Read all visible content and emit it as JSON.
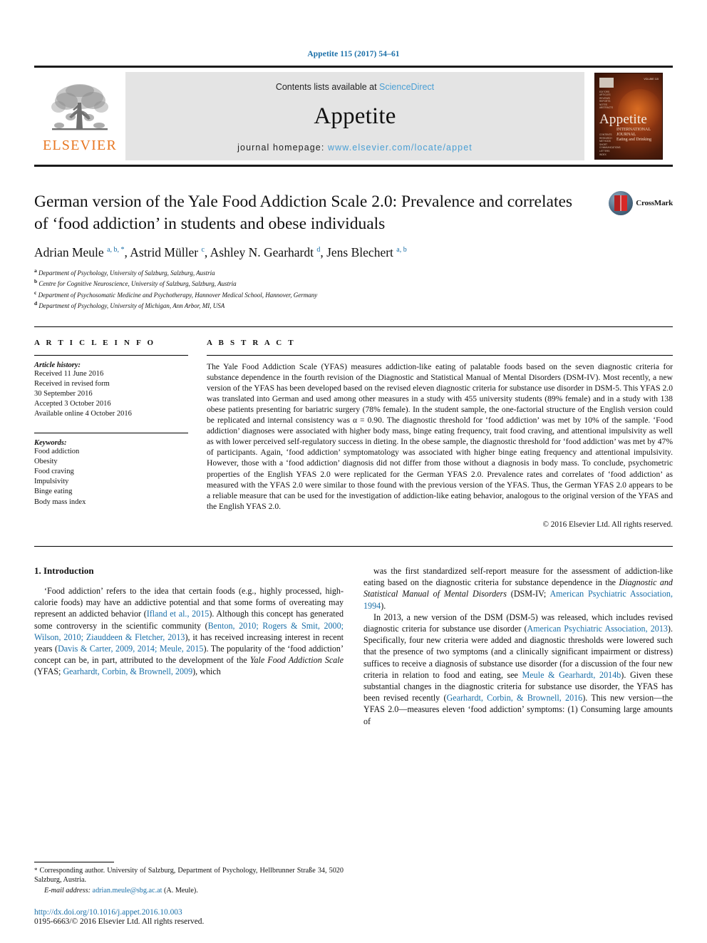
{
  "running_head": "Appetite 115 (2017) 54–61",
  "masthead": {
    "publisher_name": "ELSEVIER",
    "publisher_logo_icon": "elsevier-tree-icon",
    "contents_prefix": "Contents lists available at ",
    "contents_link": "ScienceDirect",
    "journal_name": "Appetite",
    "homepage_prefix": "journal homepage: ",
    "homepage_url": "www.elsevier.com/locate/appet",
    "cover": {
      "title": "Appetite",
      "subtitle_line1": "INTERNATIONAL JOURNAL",
      "subtitle_line2": "Eating and Drinking",
      "corner_text": "VOLUME 115"
    }
  },
  "article": {
    "title": "German version of the Yale Food Addiction Scale 2.0: Prevalence and correlates of ‘food addiction’ in students and obese individuals",
    "crossmark_label": "CrossMark",
    "authors_html": "Adrian Meule <sup>a, b, *</sup>, Astrid Müller <sup>c</sup>, Ashley N. Gearhardt <sup>d</sup>, Jens Blechert <sup>a, b</sup>",
    "affiliations": [
      {
        "marker": "a",
        "text": "Department of Psychology, University of Salzburg, Salzburg, Austria"
      },
      {
        "marker": "b",
        "text": "Centre for Cognitive Neuroscience, University of Salzburg, Salzburg, Austria"
      },
      {
        "marker": "c",
        "text": "Department of Psychosomatic Medicine and Psychotherapy, Hannover Medical School, Hannover, Germany"
      },
      {
        "marker": "d",
        "text": "Department of Psychology, University of Michigan, Ann Arbor, MI, USA"
      }
    ]
  },
  "article_info": {
    "heading": "A R T I C L E  I N F O",
    "history_label": "Article history:",
    "history": [
      "Received 11 June 2016",
      "Received in revised form",
      "30 September 2016",
      "Accepted 3 October 2016",
      "Available online 4 October 2016"
    ],
    "keywords_label": "Keywords:",
    "keywords": [
      "Food addiction",
      "Obesity",
      "Food craving",
      "Impulsivity",
      "Binge eating",
      "Body mass index"
    ]
  },
  "abstract": {
    "heading": "A B S T R A C T",
    "text": "The Yale Food Addiction Scale (YFAS) measures addiction-like eating of palatable foods based on the seven diagnostic criteria for substance dependence in the fourth revision of the Diagnostic and Statistical Manual of Mental Disorders (DSM-IV). Most recently, a new version of the YFAS has been developed based on the revised eleven diagnostic criteria for substance use disorder in DSM-5. This YFAS 2.0 was translated into German and used among other measures in a study with 455 university students (89% female) and in a study with 138 obese patients presenting for bariatric surgery (78% female). In the student sample, the one-factorial structure of the English version could be replicated and internal consistency was α = 0.90. The diagnostic threshold for ‘food addiction’ was met by 10% of the sample. ‘Food addiction’ diagnoses were associated with higher body mass, binge eating frequency, trait food craving, and attentional impulsivity as well as with lower perceived self-regulatory success in dieting. In the obese sample, the diagnostic threshold for ‘food addiction’ was met by 47% of participants. Again, ‘food addiction’ symptomatology was associated with higher binge eating frequency and attentional impulsivity. However, those with a ‘food addiction’ diagnosis did not differ from those without a diagnosis in body mass. To conclude, psychometric properties of the English YFAS 2.0 were replicated for the German YFAS 2.0. Prevalence rates and correlates of ‘food addiction’ as measured with the YFAS 2.0 were similar to those found with the previous version of the YFAS. Thus, the German YFAS 2.0 appears to be a reliable measure that can be used for the investigation of addiction-like eating behavior, analogous to the original version of the YFAS and the English YFAS 2.0.",
    "copyright": "© 2016 Elsevier Ltd. All rights reserved."
  },
  "introduction": {
    "heading": "1. Introduction",
    "paragraph1_html": "‘Food addiction’ refers to the idea that certain foods (e.g., highly processed, high-calorie foods) may have an addictive potential and that some forms of overeating may represent an addicted behavior (<span class=\"lnk\">Ifland et al., 2015</span>). Although this concept has generated some controversy in the scientific community (<span class=\"lnk\">Benton, 2010; Rogers &amp; Smit, 2000; Wilson, 2010; Ziauddeen &amp; Fletcher, 2013</span>), it has received increasing interest in recent years (<span class=\"lnk\">Davis &amp; Carter, 2009, 2014; Meule, 2015</span>). The popularity of the ‘food addiction’ concept can be, in part, attributed to the development of the <span class=\"it\">Yale Food Addiction Scale</span> (YFAS; <span class=\"lnk\">Gearhardt, Corbin, &amp; Brownell, 2009</span>), which",
    "paragraph2_html": "was the first standardized self-report measure for the assessment of addiction-like eating based on the diagnostic criteria for substance dependence in the <span class=\"it\">Diagnostic and Statistical Manual of Mental Disorders</span> (DSM-IV; <span class=\"lnk\">American Psychiatric Association, 1994</span>).",
    "paragraph3_html": "In 2013, a new version of the DSM (DSM-5) was released, which includes revised diagnostic criteria for substance use disorder (<span class=\"lnk\">American Psychiatric Association, 2013</span>). Specifically, four new criteria were added and diagnostic thresholds were lowered such that the presence of two symptoms (and a clinically significant impairment or distress) suffices to receive a diagnosis of substance use disorder (for a discussion of the four new criteria in relation to food and eating, see <span class=\"lnk\">Meule &amp; Gearhardt, 2014b</span>). Given these substantial changes in the diagnostic criteria for substance use disorder, the YFAS has been revised recently (<span class=\"lnk\">Gearhardt, Corbin, &amp; Brownell, 2016</span>). This new version—the YFAS 2.0—measures eleven ‘food addiction’ symptoms: (1) Consuming large amounts of"
  },
  "footnotes": {
    "corresponding_html": "<span class=\"star\">*</span> Corresponding author. University of Salzburg, Department of Psychology, Hellbrunner Straße 34, 5020 Salzburg, Austria.",
    "email_label": "E-mail address:",
    "email_address": "adrian.meule@sbg.ac.at",
    "email_suffix": "(A. Meule).",
    "doi": "http://dx.doi.org/10.1016/j.appet.2016.10.003",
    "issn_line": "0195-6663/© 2016 Elsevier Ltd. All rights reserved."
  },
  "colors": {
    "link_blue": "#1a6fa8",
    "sciencedirect_blue": "#4a9fd4",
    "elsevier_orange": "#e87722",
    "masthead_gray": "#e4e4e4"
  }
}
